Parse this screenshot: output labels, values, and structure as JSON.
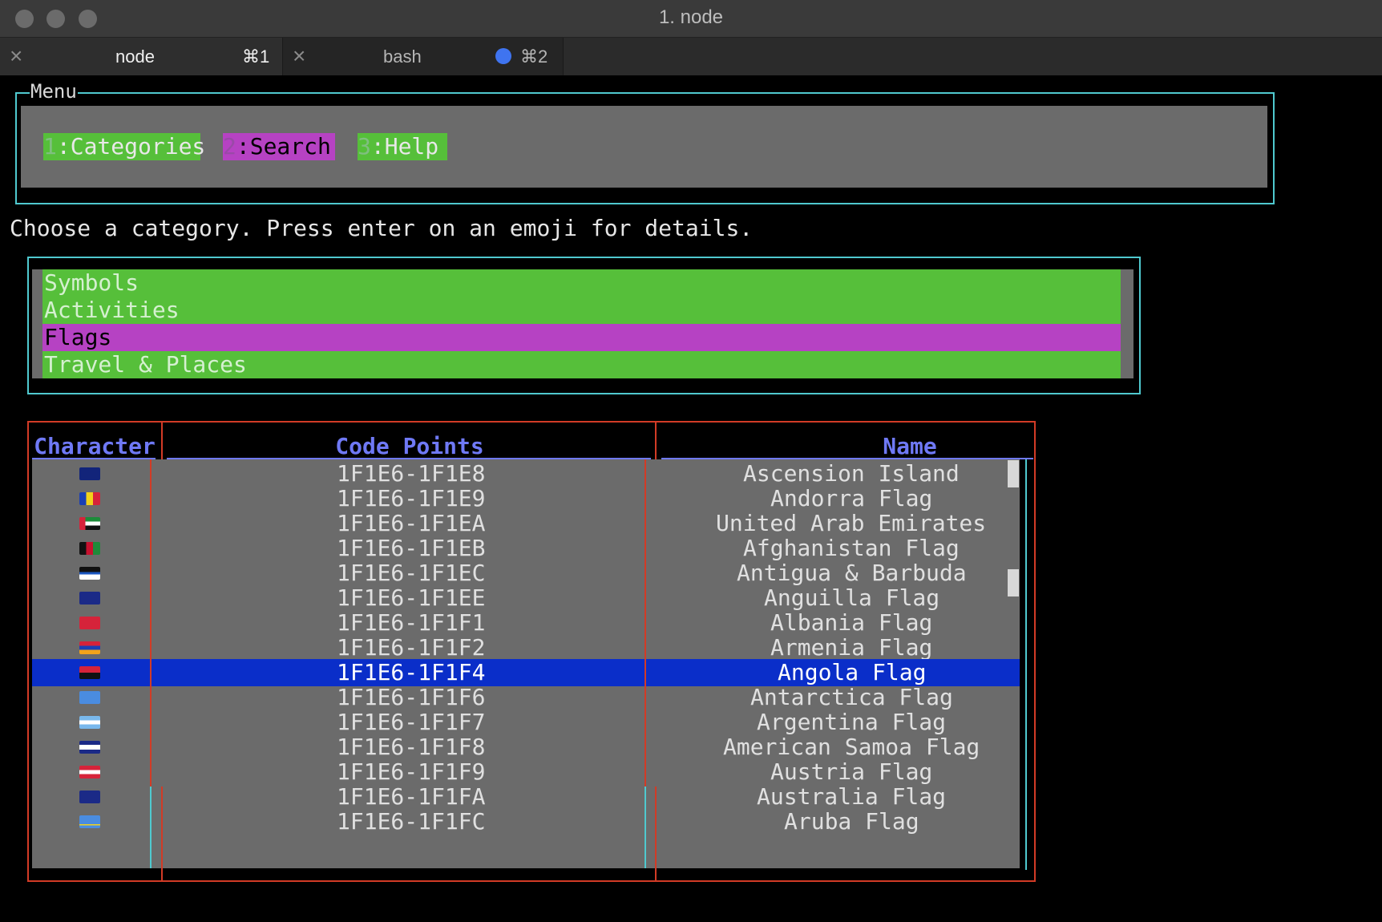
{
  "window": {
    "title": "1. node",
    "traffic_lights": [
      "close",
      "minimize",
      "zoom"
    ]
  },
  "tabs": [
    {
      "label": "node",
      "shortcut": "⌘1",
      "active": true
    },
    {
      "label": "bash",
      "shortcut": "⌘2",
      "active": false,
      "activity_dot_color": "#3f74f0"
    }
  ],
  "menu": {
    "legend": "Menu",
    "items": [
      {
        "num": "1",
        "label": ":Categories",
        "active": false
      },
      {
        "num": "2",
        "label": ":Search",
        "active": true
      },
      {
        "num": "3",
        "label": ":Help",
        "active": false
      }
    ]
  },
  "info_text": "Choose a category. Press enter on an emoji for details.",
  "categories": {
    "items": [
      "Symbols",
      "Activities",
      "Flags",
      "Travel & Places"
    ],
    "selected": "Flags"
  },
  "table": {
    "headers": {
      "character": "Character",
      "code_points": "Code Points",
      "name": "Name"
    },
    "rows": [
      {
        "code": "1F1E6-1F1E8",
        "name": "Ascension Island",
        "flag": "ascension-island"
      },
      {
        "code": "1F1E6-1F1E9",
        "name": "Andorra Flag",
        "flag": "andorra"
      },
      {
        "code": "1F1E6-1F1EA",
        "name": "United Arab Emirates",
        "flag": "united-arab-emirates"
      },
      {
        "code": "1F1E6-1F1EB",
        "name": "Afghanistan Flag",
        "flag": "afghanistan"
      },
      {
        "code": "1F1E6-1F1EC",
        "name": "Antigua & Barbuda",
        "flag": "antigua-barbuda"
      },
      {
        "code": "1F1E6-1F1EE",
        "name": "Anguilla Flag",
        "flag": "anguilla"
      },
      {
        "code": "1F1E6-1F1F1",
        "name": "Albania Flag",
        "flag": "albania"
      },
      {
        "code": "1F1E6-1F1F2",
        "name": "Armenia Flag",
        "flag": "armenia"
      },
      {
        "code": "1F1E6-1F1F4",
        "name": "Angola Flag",
        "flag": "angola",
        "selected": true
      },
      {
        "code": "1F1E6-1F1F6",
        "name": "Antarctica Flag",
        "flag": "antarctica"
      },
      {
        "code": "1F1E6-1F1F7",
        "name": "Argentina Flag",
        "flag": "argentina"
      },
      {
        "code": "1F1E6-1F1F8",
        "name": "American Samoa Flag",
        "flag": "american-samoa"
      },
      {
        "code": "1F1E6-1F1F9",
        "name": "Austria Flag",
        "flag": "austria"
      },
      {
        "code": "1F1E6-1F1FA",
        "name": "Australia Flag",
        "flag": "australia"
      },
      {
        "code": "1F1E6-1F1FC",
        "name": "Aruba Flag",
        "flag": "aruba"
      }
    ]
  },
  "colors": {
    "menu_green": "#56bf3a",
    "menu_magenta": "#b642c3",
    "panel_grey": "#6b6b6b",
    "border_cyan": "#4fc9cf",
    "border_red": "#d23b26",
    "header_blue": "#6f79f5",
    "selection_blue": "#0a2ec9"
  }
}
